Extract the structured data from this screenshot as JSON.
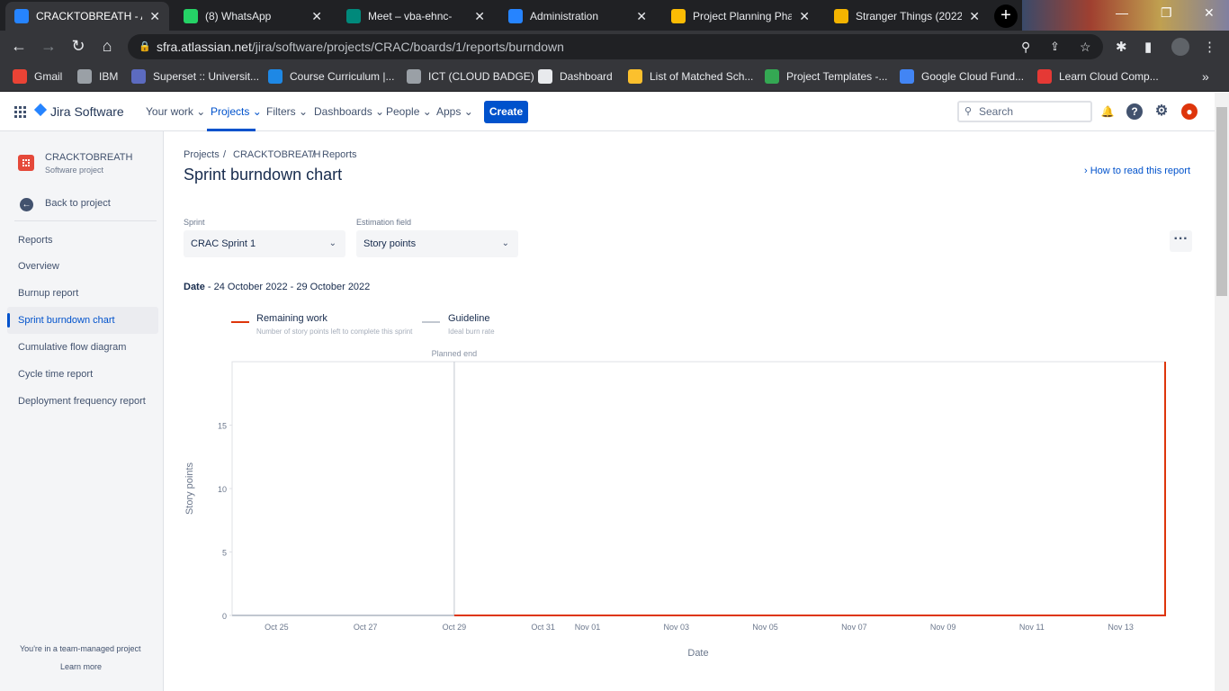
{
  "browser": {
    "tabs": [
      {
        "title": "CRACKTOBREATH - A",
        "active": true,
        "icon": "jira-icon",
        "color": "#2684ff"
      },
      {
        "title": "(8) WhatsApp",
        "active": false,
        "icon": "whatsapp-icon",
        "color": "#25d366"
      },
      {
        "title": "Meet – vba-ehnc-",
        "active": false,
        "icon": "meet-icon",
        "color": "#00897b"
      },
      {
        "title": "Administration",
        "active": false,
        "icon": "atlassian-icon",
        "color": "#2684ff"
      },
      {
        "title": "Project Planning Phas",
        "active": false,
        "icon": "drive-icon",
        "color": "#fbbc04"
      },
      {
        "title": "Stranger Things (2022",
        "active": false,
        "icon": "emoji-icon",
        "color": "#f4b400"
      }
    ],
    "url_host": "sfra.atlassian.net",
    "url_path": "/jira/software/projects/CRAC/boards/1/reports/burndown",
    "bookmarks": [
      {
        "label": "Gmail",
        "icon": "gmail-icon",
        "color": "#ea4335"
      },
      {
        "label": "IBM",
        "icon": "globe-icon",
        "color": "#9aa0a6"
      },
      {
        "label": "Superset :: Universit...",
        "icon": "superset-icon",
        "color": "#5c6bc0"
      },
      {
        "label": "Course Curriculum |...",
        "icon": "e-icon",
        "color": "#1e88e5"
      },
      {
        "label": "ICT (CLOUD BADGE)",
        "icon": "globe-icon",
        "color": "#9aa0a6"
      },
      {
        "label": "Dashboard",
        "icon": "dashboard-icon",
        "color": "#e8eaed"
      },
      {
        "label": "List of Matched Sch...",
        "icon": "star-icon",
        "color": "#fbc02d"
      },
      {
        "label": "Project Templates -...",
        "icon": "drive-icon",
        "color": "#34a853"
      },
      {
        "label": "Google Cloud Fund...",
        "icon": "gcloud-icon",
        "color": "#4285f4"
      },
      {
        "label": "Learn Cloud Comp...",
        "icon": "learn-icon",
        "color": "#e53935"
      }
    ]
  },
  "jira": {
    "brand": "Jira Software",
    "nav": [
      "Your work",
      "Projects",
      "Filters",
      "Dashboards",
      "People",
      "Apps"
    ],
    "create_label": "Create",
    "search_placeholder": "Search"
  },
  "sidebar": {
    "project_name": "CRACKTOBREATH",
    "project_type": "Software project",
    "back_label": "Back to project",
    "section_title": "Reports",
    "items": [
      "Overview",
      "Burnup report",
      "Sprint burndown chart",
      "Cumulative flow diagram",
      "Cycle time report",
      "Deployment frequency report"
    ],
    "footer_text": "You're in a team-managed project",
    "learn_more": "Learn more"
  },
  "main": {
    "breadcrumb": [
      "Projects",
      "CRACKTOBREATH",
      "Reports"
    ],
    "title": "Sprint burndown chart",
    "how_to_read": "How to read this report",
    "sprint_label": "Sprint",
    "sprint_value": "CRAC Sprint 1",
    "estimation_label": "Estimation field",
    "estimation_value": "Story points",
    "date_label": "Date",
    "date_value": " - 24 October 2022 - 29 October 2022"
  },
  "chart_data": {
    "type": "line",
    "legend": [
      {
        "name": "Remaining work",
        "desc": "Number of story points left to complete this sprint",
        "color": "#de350b"
      },
      {
        "name": "Guideline",
        "desc": "Ideal burn rate",
        "color": "#c1c7d0"
      }
    ],
    "planned_end_label": "Planned end",
    "xlabel": "Date",
    "ylabel": "Story points",
    "x_ticks": [
      "Oct 25",
      "Oct 27",
      "Oct 29",
      "Oct 31",
      "Nov 01",
      "Nov 03",
      "Nov 05",
      "Nov 07",
      "Nov 09",
      "Nov 11",
      "Nov 13"
    ],
    "x_tick_days": [
      1,
      3,
      5,
      7,
      8,
      10,
      12,
      14,
      16,
      18,
      20
    ],
    "y_ticks": [
      0,
      5,
      10,
      15
    ],
    "ylim": [
      0,
      20
    ],
    "xlim_days": [
      0,
      21
    ],
    "planned_end_day": 5,
    "series": [
      {
        "name": "Remaining work",
        "points": [
          [
            0,
            0
          ],
          [
            21,
            0
          ],
          [
            21,
            20
          ]
        ]
      },
      {
        "name": "Guideline",
        "points": [
          [
            0,
            0
          ],
          [
            5,
            0
          ]
        ]
      }
    ]
  }
}
